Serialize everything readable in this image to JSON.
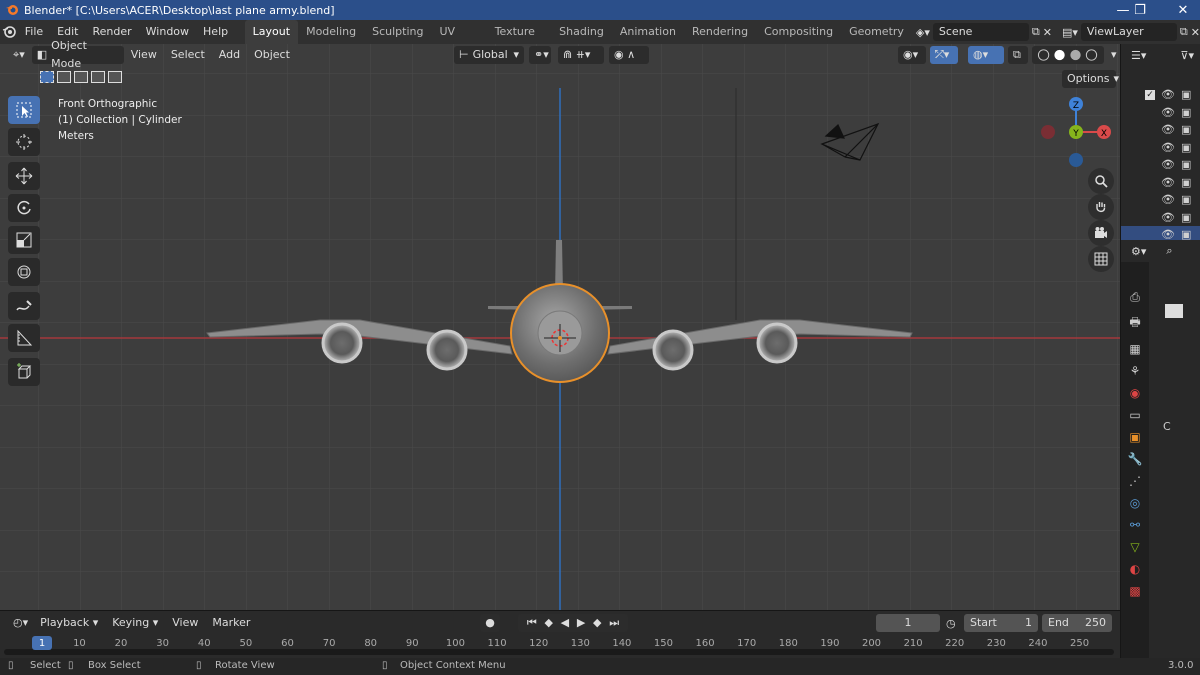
{
  "window": {
    "title": "Blender* [C:\\Users\\ACER\\Desktop\\last plane army.blend]",
    "controls": [
      "—",
      "❐",
      "✕"
    ]
  },
  "menu": [
    "File",
    "Edit",
    "Render",
    "Window",
    "Help"
  ],
  "workspaces": [
    "Layout",
    "Modeling",
    "Sculpting",
    "UV Editing",
    "Texture Paint",
    "Shading",
    "Animation",
    "Rendering",
    "Compositing",
    "Geometry Nod"
  ],
  "active_workspace": "Layout",
  "scene": {
    "name": "Scene",
    "view_layer": "ViewLayer"
  },
  "viewport_header": {
    "mode": "Object Mode",
    "menus": [
      "View",
      "Select",
      "Add",
      "Object"
    ],
    "transform_orientation": "Global",
    "options_label": "Options"
  },
  "viewport_overlay": {
    "view_name": "Front Orthographic",
    "collection": "(1) Collection | Cylinder",
    "units": "Meters"
  },
  "gizmo_axes": [
    "Z",
    "Y",
    "X"
  ],
  "toolbar": [
    "select-box",
    "cursor",
    "move",
    "rotate",
    "scale",
    "transform",
    "annotate",
    "measure",
    "add-cube"
  ],
  "timeline": {
    "menus": [
      "Playback",
      "Keying",
      "View",
      "Marker"
    ],
    "current_frame": "1",
    "start_label": "Start",
    "start_value": "1",
    "end_label": "End",
    "end_value": "250",
    "ruler": [
      "1",
      "10",
      "20",
      "30",
      "40",
      "50",
      "60",
      "70",
      "80",
      "90",
      "100",
      "110",
      "120",
      "130",
      "140",
      "150",
      "160",
      "170",
      "180",
      "190",
      "200",
      "210",
      "220",
      "230",
      "240",
      "250"
    ]
  },
  "statusbar": {
    "select": "Select",
    "box_select": "Box Select",
    "rotate_view": "Rotate View",
    "context_menu": "Object Context Menu",
    "version": "3.0.0"
  },
  "properties_panel": {
    "label_c": "C"
  },
  "colors": {
    "accent_blue": "#4772b3",
    "selection_orange": "#e8902a",
    "x_axis": "#d94a4a",
    "y_axis": "#86b51c",
    "z_axis": "#3f82d8"
  }
}
